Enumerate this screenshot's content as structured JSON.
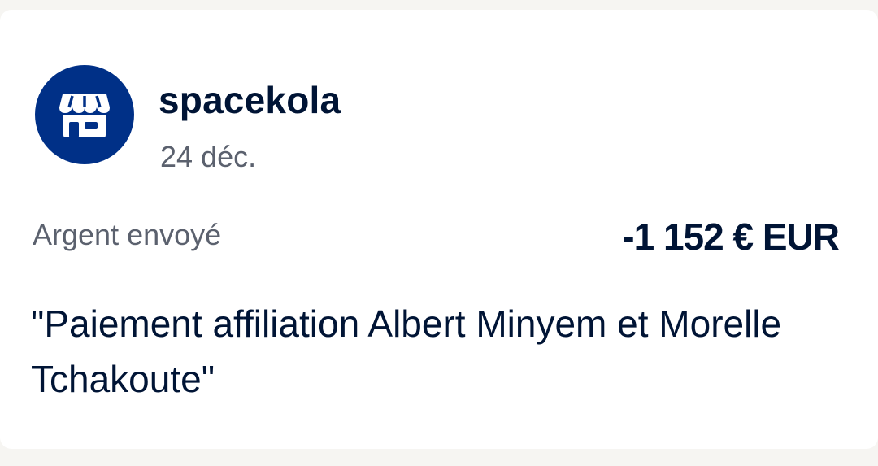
{
  "merchant": {
    "name": "spacekola",
    "icon": "store-icon",
    "avatar_color": "#003087"
  },
  "transaction": {
    "date": "24 déc.",
    "type_label": "Argent envoyé",
    "amount": "-1 152 € EUR",
    "note": "\"Paiement affiliation Albert Minyem et Morelle Tchakoute\""
  },
  "colors": {
    "primary_text": "#001435",
    "secondary_text": "#5b616e",
    "card_background": "#ffffff",
    "page_background": "#f6f5f2"
  }
}
